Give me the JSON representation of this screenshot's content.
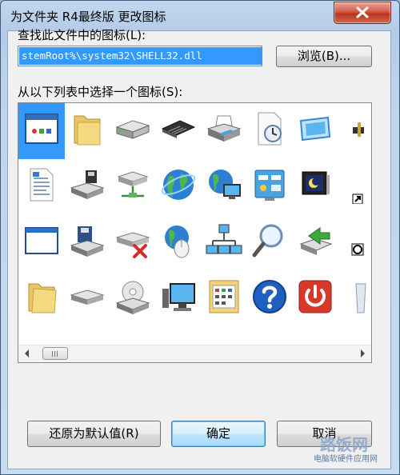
{
  "window": {
    "title": "为文件夹 R4最终版 更改图标"
  },
  "labels": {
    "find_icons": "查找此文件中的图标(L):",
    "choose_icon": "从以下列表中选择一个图标(S):"
  },
  "path_input": {
    "value": "stemRoot%\\system32\\SHELL32.dll"
  },
  "buttons": {
    "browse": "浏览(B)...",
    "restore_default": "还原为默认值(R)",
    "ok": "确定",
    "cancel": "取消"
  },
  "icons": [
    "application-window-icon",
    "folder-icon",
    "hard-drive-icon",
    "memory-chip-icon",
    "printer-icon",
    "clock-document-icon",
    "monitor-display-icon",
    "partial-icon",
    "document-text-icon",
    "floppy-drive-computer-icon",
    "network-drive-icon",
    "globe-icon",
    "globe-computer-icon",
    "control-panel-icon",
    "monitor-moon-icon",
    "shortcut-arrow-icon",
    "blank-window-icon",
    "floppy-disk-icon",
    "disconnected-drive-icon",
    "globe-mouse-icon",
    "network-computers-icon",
    "magnifier-icon",
    "green-arrow-drive-icon",
    "clock-overlay-icon",
    "open-folder-icon",
    "removable-drive-icon",
    "cd-drive-icon",
    "computer-monitor-icon",
    "calendar-board-icon",
    "help-question-icon",
    "power-shutdown-icon",
    "recycle-bin-icon"
  ],
  "watermark": {
    "big": "路饭网",
    "small": "电脑软硬件应用网"
  }
}
